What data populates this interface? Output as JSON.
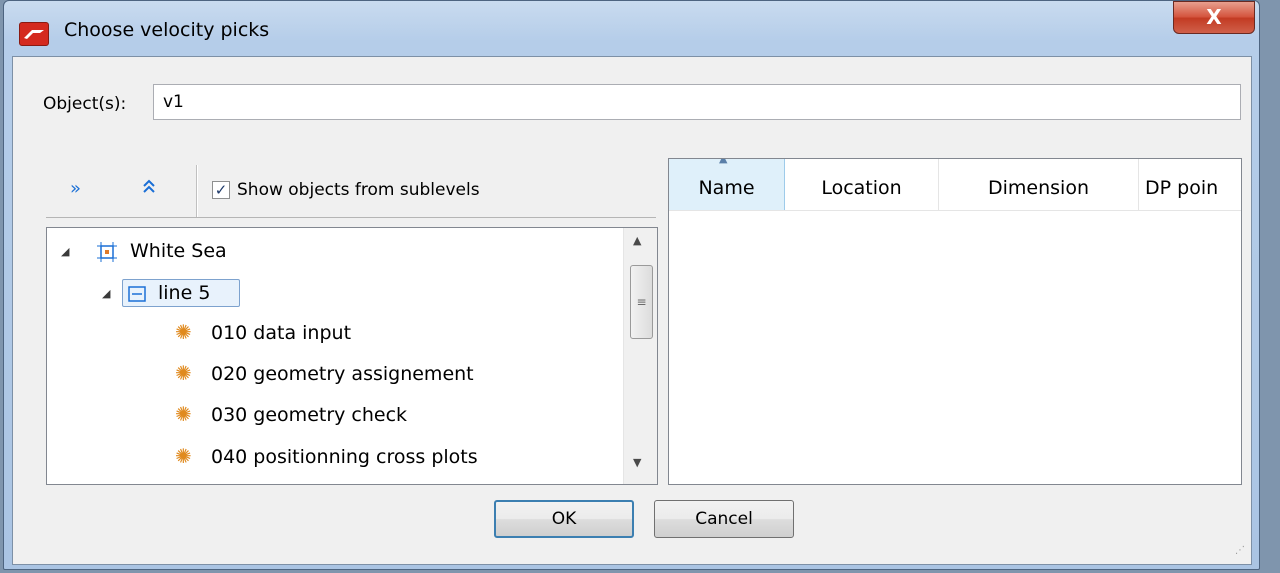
{
  "window": {
    "title": "Choose velocity picks",
    "close_glyph": "X"
  },
  "object_field": {
    "label": "Object(s):",
    "value": "v1"
  },
  "toolbar": {
    "expand_all_icon": "double-chevron-right-icon",
    "collapse_all_icon": "double-chevron-up-icon",
    "show_sublevels_label": "Show objects from sublevels",
    "show_sublevels_checked": true
  },
  "tree": {
    "items": [
      {
        "label": "White Sea",
        "level": 0,
        "icon": "survey-icon",
        "expanded": true
      },
      {
        "label": "line 5",
        "level": 1,
        "icon": "line-icon",
        "expanded": true,
        "selected": true
      },
      {
        "label": "010 data input",
        "level": 2,
        "icon": "gear-icon"
      },
      {
        "label": "020 geometry assignement",
        "level": 2,
        "icon": "gear-icon"
      },
      {
        "label": "030 geometry check",
        "level": 2,
        "icon": "gear-icon"
      },
      {
        "label": "040 positionning cross plots",
        "level": 2,
        "icon": "gear-icon"
      }
    ]
  },
  "list": {
    "columns": [
      "Name",
      "Location",
      "Dimension",
      "DP poin"
    ],
    "sorted_column": "Name",
    "rows": []
  },
  "buttons": {
    "ok": "OK",
    "cancel": "Cancel"
  },
  "colors": {
    "accent": "#1a6fd6",
    "app_icon": "#d42a1f",
    "gear": "#e08a1e",
    "selection": "#dff0fa"
  }
}
